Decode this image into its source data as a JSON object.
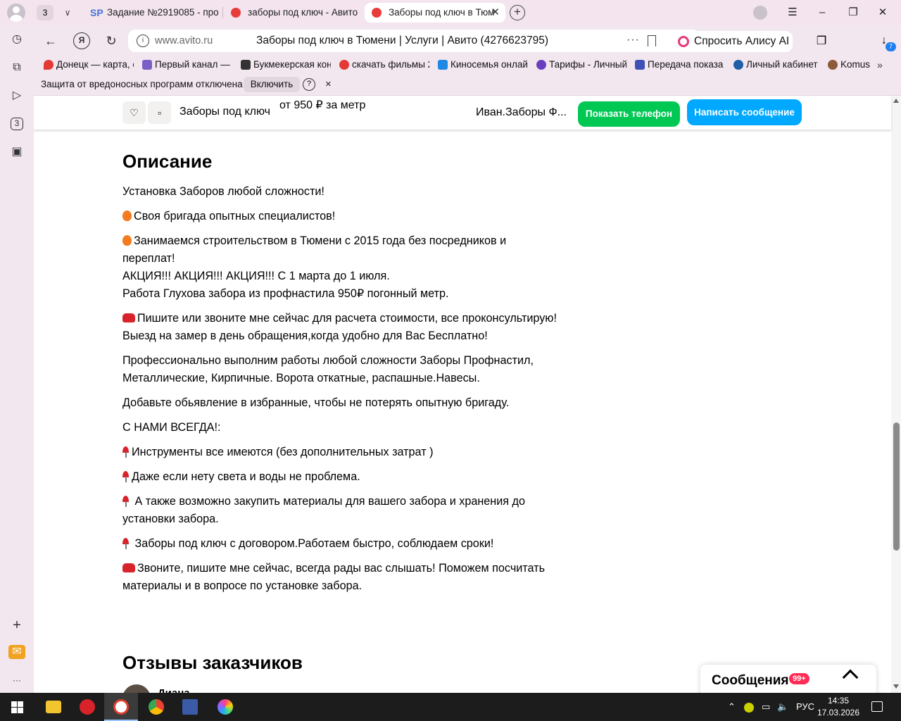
{
  "browser": {
    "tab_count": "3",
    "tabs": [
      {
        "title": "Задание №2919085 - про",
        "favicon": "SP"
      },
      {
        "title": "заборы под ключ - Авито"
      },
      {
        "title": "Заборы под ключ в Тюм"
      }
    ],
    "address": {
      "host": "www.avito.ru",
      "page_title": "Заборы под ключ в Тюмени | Услуги | Авито (4276623795)",
      "more": "···"
    },
    "alice_button": "Спросить Алису AI",
    "downloads_badge": "7",
    "bookmarks": [
      {
        "label": "Донецк — карта, с",
        "color": "#e53935"
      },
      {
        "label": "Первый канал — с",
        "color": "#7b5fc7"
      },
      {
        "label": "Букмекерская кон",
        "color": "#333333"
      },
      {
        "label": "скачать фильмы 2",
        "color": "#e53935"
      },
      {
        "label": "Киносемья онлай",
        "color": "#1e88e5"
      },
      {
        "label": "Тарифы - Личный",
        "color": "#6a3fbf"
      },
      {
        "label": "Передача показа",
        "color": "#3f51b5"
      },
      {
        "label": "Личный кабинет",
        "color": "#1e5fa8"
      },
      {
        "label": "Komus",
        "color": "#8d5b3a"
      }
    ],
    "bookmarks_more": "»",
    "notice": {
      "text": "Защита от вредоносных программ отключена",
      "enable_button": "Включить",
      "help": "?",
      "close": "×"
    },
    "sidebar_tab_count": "3"
  },
  "listing": {
    "sticky_title": "Заборы под ключ",
    "sticky_price": "от 950 ₽ за метр",
    "seller": "Иван.Заборы Ф...",
    "show_phone": "Показать телефон",
    "write_message": "Написать сообщение",
    "description_heading": "Описание",
    "description": [
      {
        "icon": "",
        "text": "Установка Заборов любой сложности!"
      },
      {
        "icon": "fire",
        "text": "Своя бригада опытных специалистов!"
      },
      {
        "icon": "fire",
        "text": "Занимаемся строительством в Тюмени с 2015 года без посредников и переплат!\nАКЦИЯ!!! АКЦИЯ!!! АКЦИЯ!!! С 1 марта до 1 июля.\nРабота Глухова забора из профнастила 950₽ погонный метр."
      },
      {
        "icon": "phone",
        "text": "Пишите или звоните мне сейчас для расчета стоимости, все проконсультирую! Выезд на замер в день обращения,когда удобно для Вас Бесплатно!"
      },
      {
        "icon": "",
        "text": "Профессионально выполним работы любой сложности Заборы Профнастил, Металлические, Кирпичные. Ворота откатные, распашные.Навесы."
      },
      {
        "icon": "",
        "text": "Добавьте обьявление в избранные, чтобы не потерять опытную бригаду."
      },
      {
        "icon": "",
        "text": "С НАМИ ВСЕГДА!:"
      },
      {
        "icon": "pin",
        "text": "Инструменты все имеются (без дополнительных затрат )"
      },
      {
        "icon": "pin",
        "text": "Даже если нету света и воды не проблема."
      },
      {
        "icon": "pin",
        "text": " А также возможно закупить материалы для вашего забора и хранения до установки забора."
      },
      {
        "icon": "pin",
        "text": " Заборы под ключ с договором.Работаем быстро, соблюдаем сроки!"
      },
      {
        "icon": "phone",
        "text": "Звоните, пишите мне сейчас, всегда рады вас слышать! Поможем посчитать материалы и в вопросе по установке забора."
      }
    ],
    "reviews_heading": "Отзывы заказчиков",
    "reviewer_name": "Диана",
    "messages_label": "Сообщения",
    "messages_badge": "99+"
  },
  "taskbar": {
    "tray_lang": "РУС",
    "time": "14:35",
    "date": "17.03.2026"
  },
  "colors": {
    "phone_button": "#00c853",
    "message_button": "#00a8ff",
    "badge": "#ff2c55",
    "browser_chrome": "#f2e6ef"
  }
}
